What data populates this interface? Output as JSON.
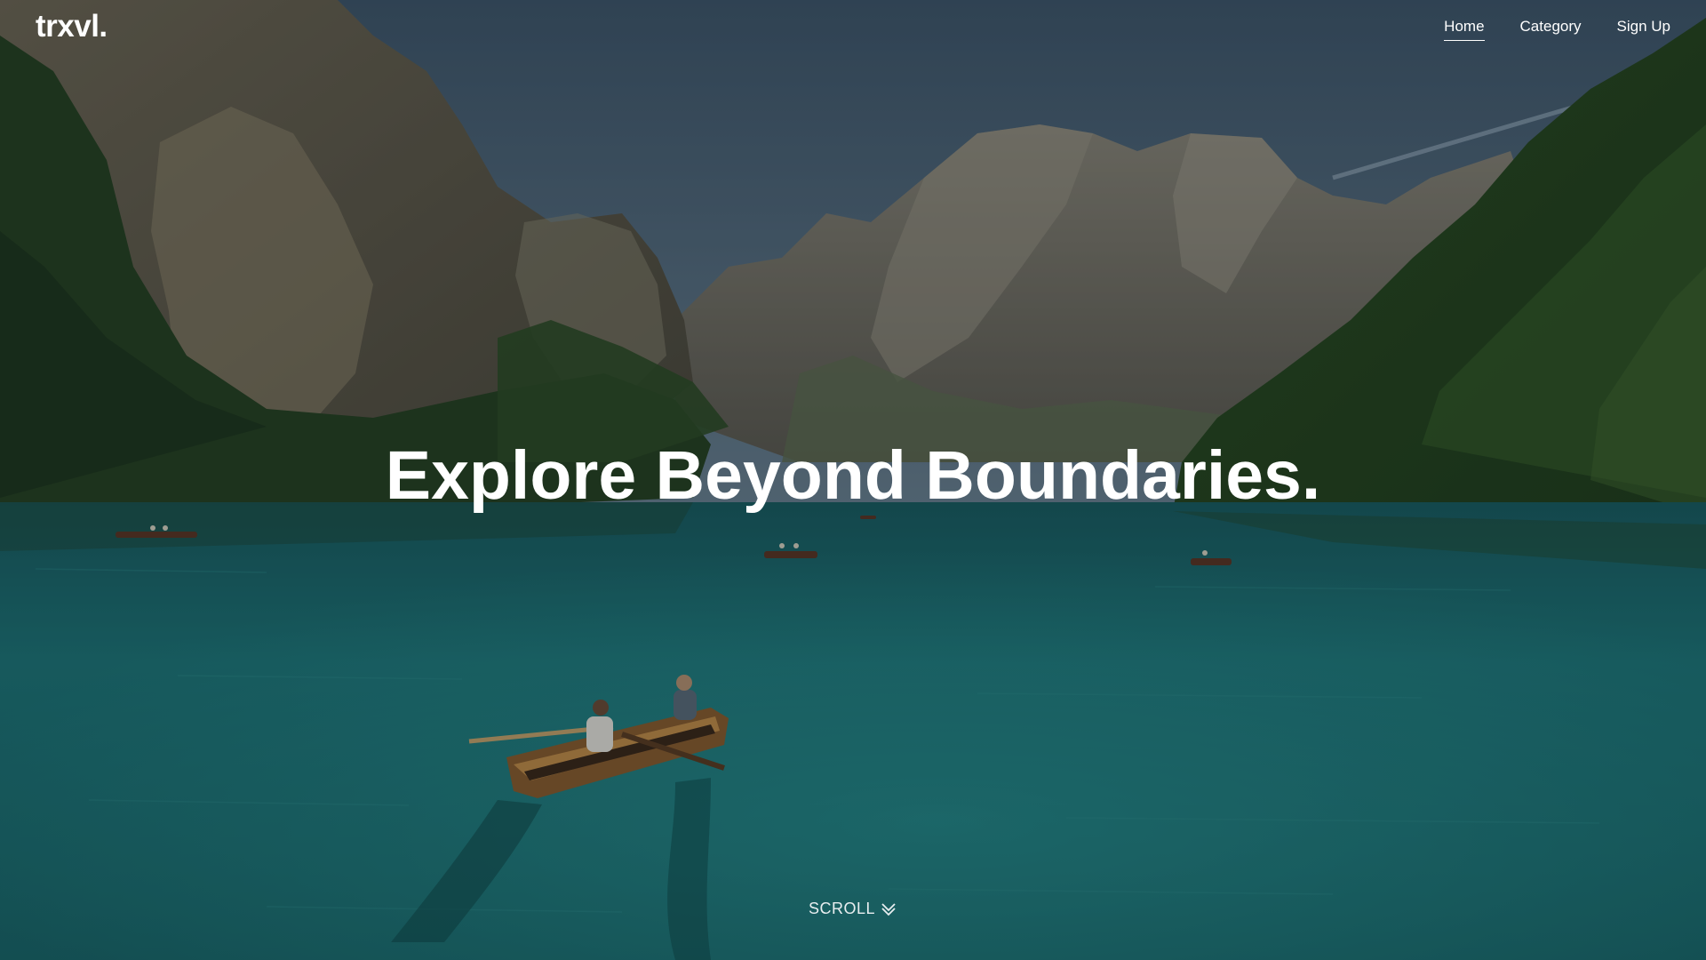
{
  "brand": {
    "logo": "trxvl."
  },
  "nav": {
    "items": [
      {
        "label": "Home",
        "active": true
      },
      {
        "label": "Category",
        "active": false
      },
      {
        "label": "Sign Up",
        "active": false
      }
    ]
  },
  "hero": {
    "headline": "Explore Beyond Boundaries.",
    "scroll_label": "SCROLL",
    "scroll_icon": "double-chevron-down-icon",
    "background_image": "mountain-lake-with-rowboats"
  },
  "colors": {
    "text": "#ffffff",
    "water": "#1f7f80",
    "sky": "#4a6275"
  }
}
